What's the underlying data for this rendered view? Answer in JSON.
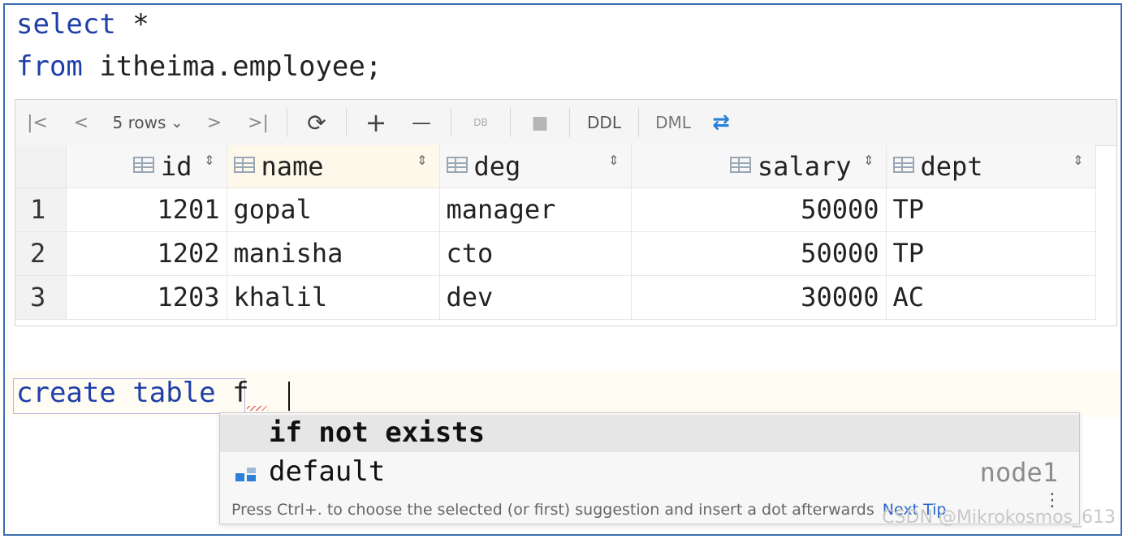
{
  "editor": {
    "line1_kw": "select",
    "line1_rest": " *",
    "line2_kw": "from",
    "line2_rest": " itheima.employee;",
    "create_kw": "create table",
    "typed": " f"
  },
  "toolbar": {
    "first_page": "|<",
    "prev_page": "<",
    "rows_label": "5 rows",
    "rows_chevron": "⌄",
    "next_page": ">",
    "last_page": ">|",
    "refresh": "⟳",
    "add": "+",
    "remove": "—",
    "submit": "DB",
    "stop": "■",
    "ddl": "DDL",
    "dml": "DML",
    "compare": "⇄"
  },
  "table": {
    "columns": [
      "id",
      "name",
      "deg",
      "salary",
      "dept"
    ],
    "sort_glyph": "⇕",
    "rows": [
      {
        "num": "1",
        "id": "1201",
        "name": "gopal",
        "deg": "manager",
        "salary": "50000",
        "dept": "TP"
      },
      {
        "num": "2",
        "id": "1202",
        "name": "manisha",
        "deg": "cto",
        "salary": "50000",
        "dept": "TP"
      },
      {
        "num": "3",
        "id": "1203",
        "name": "khalil",
        "deg": "dev",
        "salary": "30000",
        "dept": "AC"
      }
    ]
  },
  "autocomplete": {
    "items": [
      {
        "label": "if not exists",
        "type": ""
      },
      {
        "label": "default",
        "type": "node1"
      }
    ],
    "hint": "Press Ctrl+. to choose the selected (or first) suggestion and insert a dot afterwards",
    "next_tip": "Next Tip",
    "more": "⋮"
  },
  "watermark": "CSDN @Mikrokosmos_613",
  "colors": {
    "keyword": "#1f3fa8",
    "frame": "#3b6db3",
    "link": "#2a66c9"
  }
}
